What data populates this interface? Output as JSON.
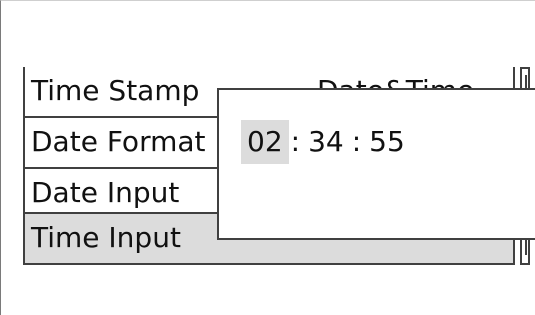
{
  "menu": {
    "items": [
      {
        "label": "Time Stamp",
        "value": "Date&Time"
      },
      {
        "label": "Date Format",
        "value": ""
      },
      {
        "label": "Date Input",
        "value": ""
      },
      {
        "label": "Time Input",
        "value": ""
      }
    ],
    "selected_index": 3
  },
  "time_editor": {
    "hours": "02",
    "minutes": "34",
    "seconds": "55",
    "separator": ":",
    "active_field": "hours"
  },
  "colors": {
    "selected_background": "#dcdcdc",
    "border": "#404040",
    "background": "#ffffff",
    "text": "#111111"
  }
}
